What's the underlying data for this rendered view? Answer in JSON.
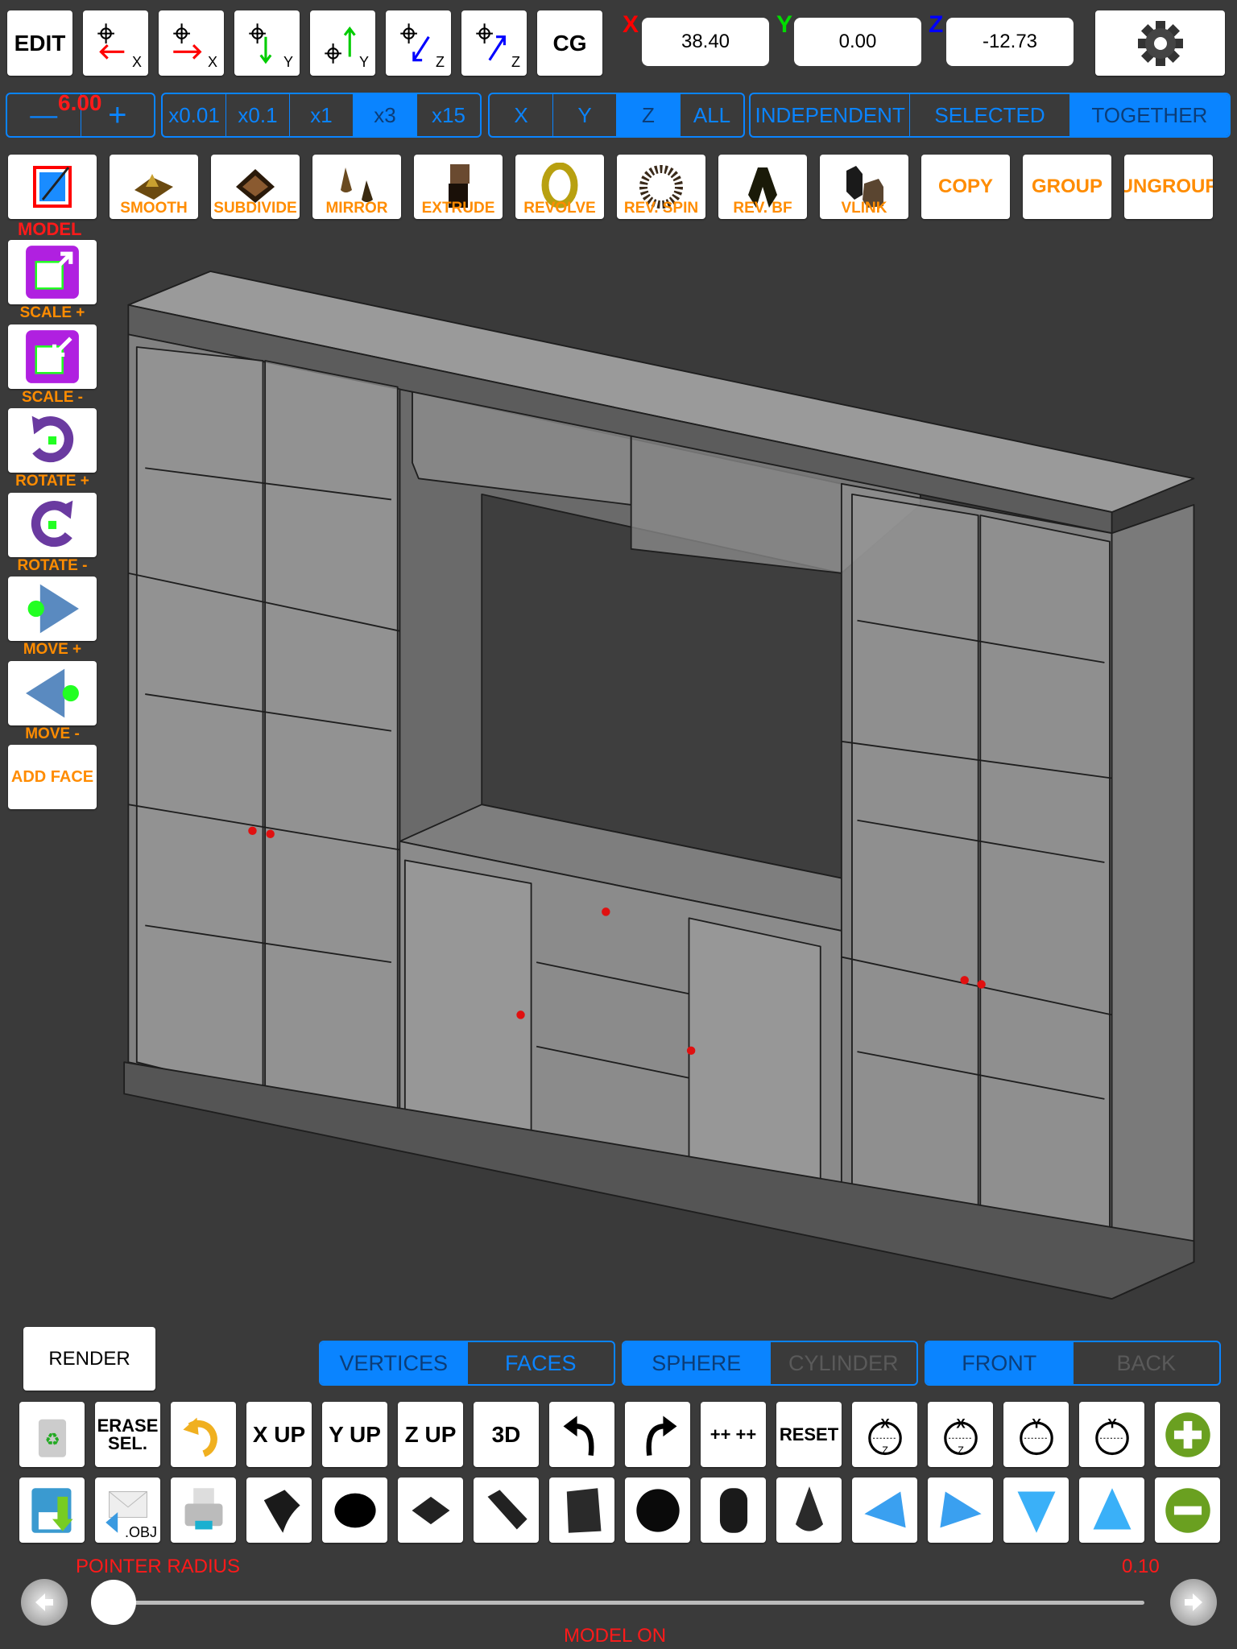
{
  "colors": {
    "accent": "#0a84ff",
    "label_orange": "#ff8c00",
    "label_red": "#ff1a1a",
    "background": "#3a3a3a"
  },
  "top_bar": {
    "buttons": [
      {
        "name": "edit-button",
        "label": "EDIT"
      },
      {
        "name": "move-left-x-button",
        "label": "X",
        "icon": "crosshair-arrow-left-red",
        "arrow_color": "#ff0000"
      },
      {
        "name": "move-right-x-button",
        "label": "X",
        "icon": "crosshair-arrow-right-red",
        "arrow_color": "#ff0000"
      },
      {
        "name": "move-down-y-button",
        "label": "Y",
        "icon": "crosshair-arrow-down-green",
        "arrow_color": "#00cc00"
      },
      {
        "name": "move-up-y-button",
        "label": "Y",
        "icon": "crosshair-arrow-up-green",
        "arrow_color": "#00cc00"
      },
      {
        "name": "move-in-z-button",
        "label": "Z",
        "icon": "crosshair-arrow-diag-in-blue",
        "arrow_color": "#0000ff"
      },
      {
        "name": "move-out-z-button",
        "label": "Z",
        "icon": "crosshair-arrow-diag-out-blue",
        "arrow_color": "#0000ff"
      },
      {
        "name": "cg-button",
        "label": "CG"
      }
    ],
    "coords": [
      {
        "axis": "X",
        "value": "38.40",
        "color": "#ff0000"
      },
      {
        "axis": "Y",
        "value": "0.00",
        "color": "#00dd00"
      },
      {
        "axis": "Z",
        "value": "-12.73",
        "color": "#0000ff"
      }
    ],
    "settings_icon": "gear-icon"
  },
  "step": {
    "minus": "—",
    "value": "6.00",
    "plus": "+"
  },
  "multipliers": {
    "options": [
      "x0.01",
      "x0.1",
      "x1",
      "x3",
      "x15"
    ],
    "selected": "x3"
  },
  "axes": {
    "options": [
      "X",
      "Y",
      "Z",
      "ALL"
    ],
    "selected": "Z"
  },
  "modes": {
    "options": [
      "INDEPENDENT",
      "SELECTED",
      "TOGETHER"
    ],
    "selected": "TOGETHER"
  },
  "tools": [
    {
      "label": "",
      "icon": "model-edit-icon",
      "caption": "MODEL"
    },
    {
      "label": "SMOOTH",
      "icon": "smooth-icon"
    },
    {
      "label": "SUBDIVIDE",
      "icon": "subdivide-icon"
    },
    {
      "label": "MIRROR",
      "icon": "mirror-icon"
    },
    {
      "label": "EXTRUDE",
      "icon": "extrude-icon"
    },
    {
      "label": "REVOLVE",
      "icon": "revolve-icon"
    },
    {
      "label": "REV. SPIN",
      "icon": "rev-spin-icon"
    },
    {
      "label": "REV. BF",
      "icon": "rev-bf-icon"
    },
    {
      "label": "VLINK",
      "icon": "vlink-icon"
    },
    {
      "label": "COPY"
    },
    {
      "label": "GROUP"
    },
    {
      "label": "UNGROUP"
    }
  ],
  "side_tools": [
    {
      "label": "SCALE +",
      "icon": "scale-up-icon"
    },
    {
      "label": "SCALE -",
      "icon": "scale-down-icon"
    },
    {
      "label": "ROTATE +",
      "icon": "rotate-cw-icon"
    },
    {
      "label": "ROTATE -",
      "icon": "rotate-ccw-icon"
    },
    {
      "label": "MOVE +",
      "icon": "move-right-icon"
    },
    {
      "label": "MOVE -",
      "icon": "move-left-icon"
    },
    {
      "label": "ADD FACE",
      "text_button": true
    }
  ],
  "render": {
    "label": "RENDER"
  },
  "bottom_segments": [
    {
      "options": [
        "VERTICES",
        "FACES"
      ],
      "selected": "VERTICES"
    },
    {
      "options": [
        "SPHERE",
        "CYLINDER"
      ],
      "selected": "SPHERE",
      "disabled": "CYLINDER"
    },
    {
      "options": [
        "FRONT",
        "BACK"
      ],
      "selected": "FRONT",
      "disabled": "BACK"
    }
  ],
  "icon_row1": [
    {
      "icon": "trash-icon"
    },
    {
      "text": "ERASE SEL."
    },
    {
      "icon": "undo-curve-icon"
    },
    {
      "text": "X UP"
    },
    {
      "text": "Y UP"
    },
    {
      "text": "Z UP"
    },
    {
      "text": "3D"
    },
    {
      "icon": "undo-icon"
    },
    {
      "icon": "redo-icon"
    },
    {
      "text": "++ ++"
    },
    {
      "text": "RESET"
    },
    {
      "icon": "rotate-xz-ccw-icon",
      "glyph": "X Z"
    },
    {
      "icon": "rotate-xz-cw-icon",
      "glyph": "X Z"
    },
    {
      "icon": "rotate-y-ccw-icon",
      "glyph": "Y"
    },
    {
      "icon": "rotate-y-cw-icon",
      "glyph": "Y"
    },
    {
      "icon": "zoom-in-plus-icon"
    }
  ],
  "icon_row2": [
    {
      "icon": "save-icon"
    },
    {
      "icon": "export-obj-icon",
      "text": ".OBJ"
    },
    {
      "icon": "print-icon"
    },
    {
      "icon": "curved-plane-icon"
    },
    {
      "icon": "disc-icon"
    },
    {
      "icon": "square-plane-icon"
    },
    {
      "icon": "bent-plane-icon"
    },
    {
      "icon": "cube-icon"
    },
    {
      "icon": "sphere-icon"
    },
    {
      "icon": "cylinder-icon"
    },
    {
      "icon": "cone-icon"
    },
    {
      "icon": "arrow-left-blue-icon"
    },
    {
      "icon": "arrow-right-blue-icon"
    },
    {
      "icon": "arrow-down-blue-icon"
    },
    {
      "icon": "arrow-up-blue-icon"
    },
    {
      "icon": "zoom-out-minus-icon"
    }
  ],
  "slider": {
    "label": "POINTER RADIUS",
    "value": "0.10",
    "fraction": 0.0
  },
  "status": "MODEL ON"
}
